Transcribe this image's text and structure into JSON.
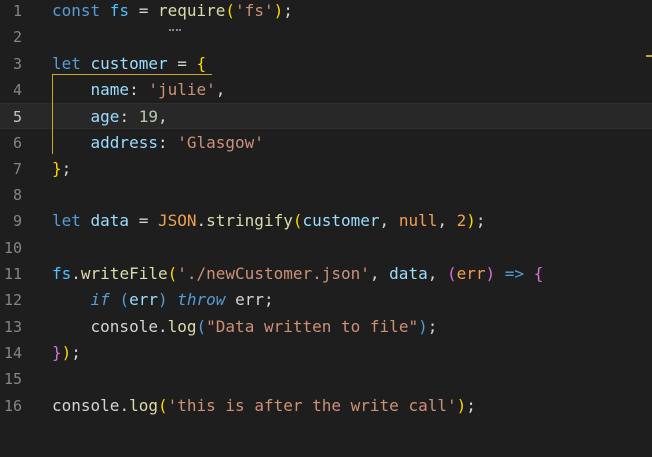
{
  "editor": {
    "language": "javascript",
    "current_line": 5,
    "lines": [
      {
        "n": "1",
        "tokens": [
          {
            "t": "const ",
            "c": "blue"
          },
          {
            "t": "fs",
            "c": "cyan"
          },
          {
            "t": " = ",
            "c": "plain"
          },
          {
            "t": "require",
            "c": "fn"
          },
          {
            "t": "(",
            "c": "yel"
          },
          {
            "t": "'fs'",
            "c": "str"
          },
          {
            "t": ")",
            "c": "yel"
          },
          {
            "t": ";",
            "c": "plain"
          }
        ]
      },
      {
        "n": "2",
        "tokens": []
      },
      {
        "n": "3",
        "tokens": [
          {
            "t": "let ",
            "c": "blue"
          },
          {
            "t": "customer",
            "c": "var"
          },
          {
            "t": " = ",
            "c": "plain"
          },
          {
            "t": "{",
            "c": "yel"
          }
        ]
      },
      {
        "n": "4",
        "tokens": [
          {
            "t": "    ",
            "c": "plain"
          },
          {
            "t": "name",
            "c": "prop"
          },
          {
            "t": ": ",
            "c": "plain"
          },
          {
            "t": "'julie'",
            "c": "str"
          },
          {
            "t": ",",
            "c": "plain"
          }
        ]
      },
      {
        "n": "5",
        "tokens": [
          {
            "t": "    ",
            "c": "plain"
          },
          {
            "t": "age",
            "c": "prop"
          },
          {
            "t": ": ",
            "c": "plain"
          },
          {
            "t": "19",
            "c": "num"
          },
          {
            "t": ",",
            "c": "plain"
          }
        ]
      },
      {
        "n": "6",
        "tokens": [
          {
            "t": "    ",
            "c": "plain"
          },
          {
            "t": "address",
            "c": "prop"
          },
          {
            "t": ": ",
            "c": "plain"
          },
          {
            "t": "'Glasgow'",
            "c": "str"
          }
        ]
      },
      {
        "n": "7",
        "tokens": [
          {
            "t": "}",
            "c": "yel"
          },
          {
            "t": ";",
            "c": "plain"
          }
        ]
      },
      {
        "n": "8",
        "tokens": []
      },
      {
        "n": "9",
        "tokens": [
          {
            "t": "let ",
            "c": "blue"
          },
          {
            "t": "data",
            "c": "var"
          },
          {
            "t": " = ",
            "c": "plain"
          },
          {
            "t": "JSON",
            "c": "orng"
          },
          {
            "t": ".",
            "c": "plain"
          },
          {
            "t": "stringify",
            "c": "fn"
          },
          {
            "t": "(",
            "c": "yel"
          },
          {
            "t": "customer",
            "c": "var"
          },
          {
            "t": ", ",
            "c": "plain"
          },
          {
            "t": "null",
            "c": "orng"
          },
          {
            "t": ", ",
            "c": "plain"
          },
          {
            "t": "2",
            "c": "orng"
          },
          {
            "t": ")",
            "c": "yel"
          },
          {
            "t": ";",
            "c": "plain"
          }
        ]
      },
      {
        "n": "10",
        "tokens": []
      },
      {
        "n": "11",
        "tokens": [
          {
            "t": "fs",
            "c": "cyan"
          },
          {
            "t": ".",
            "c": "plain"
          },
          {
            "t": "writeFile",
            "c": "fn"
          },
          {
            "t": "(",
            "c": "yel"
          },
          {
            "t": "'./newCustomer.json'",
            "c": "str"
          },
          {
            "t": ", ",
            "c": "plain"
          },
          {
            "t": "data",
            "c": "var"
          },
          {
            "t": ", ",
            "c": "plain"
          },
          {
            "t": "(",
            "c": "pur"
          },
          {
            "t": "err",
            "c": "orng"
          },
          {
            "t": ")",
            "c": "pur"
          },
          {
            "t": " => ",
            "c": "blue"
          },
          {
            "t": "{",
            "c": "pur"
          }
        ]
      },
      {
        "n": "12",
        "tokens": [
          {
            "t": "    ",
            "c": "plain"
          },
          {
            "t": "if",
            "c": "kwc"
          },
          {
            "t": " ",
            "c": "plain"
          },
          {
            "t": "(",
            "c": "blue"
          },
          {
            "t": "err",
            "c": "var"
          },
          {
            "t": ")",
            "c": "blue"
          },
          {
            "t": " ",
            "c": "plain"
          },
          {
            "t": "throw",
            "c": "kwc"
          },
          {
            "t": " err;",
            "c": "plain"
          }
        ]
      },
      {
        "n": "13",
        "tokens": [
          {
            "t": "    ",
            "c": "plain"
          },
          {
            "t": "console",
            "c": "plain"
          },
          {
            "t": ".",
            "c": "plain"
          },
          {
            "t": "log",
            "c": "fn"
          },
          {
            "t": "(",
            "c": "blue"
          },
          {
            "t": "\"Data written to file\"",
            "c": "str"
          },
          {
            "t": ")",
            "c": "blue"
          },
          {
            "t": ";",
            "c": "plain"
          }
        ]
      },
      {
        "n": "14",
        "tokens": [
          {
            "t": "}",
            "c": "pur"
          },
          {
            "t": ")",
            "c": "yel"
          },
          {
            "t": ";",
            "c": "plain"
          }
        ]
      },
      {
        "n": "15",
        "tokens": []
      },
      {
        "n": "16",
        "tokens": [
          {
            "t": "console",
            "c": "plain"
          },
          {
            "t": ".",
            "c": "plain"
          },
          {
            "t": "log",
            "c": "fn"
          },
          {
            "t": "(",
            "c": "yel"
          },
          {
            "t": "'this is after the write call'",
            "c": "str"
          },
          {
            "t": ")",
            "c": "yel"
          },
          {
            "t": ";",
            "c": "plain"
          }
        ]
      }
    ]
  },
  "colors": {
    "background": "#1e1e1e",
    "bracket_highlight": "#c8a826",
    "line_number": "#858585"
  }
}
